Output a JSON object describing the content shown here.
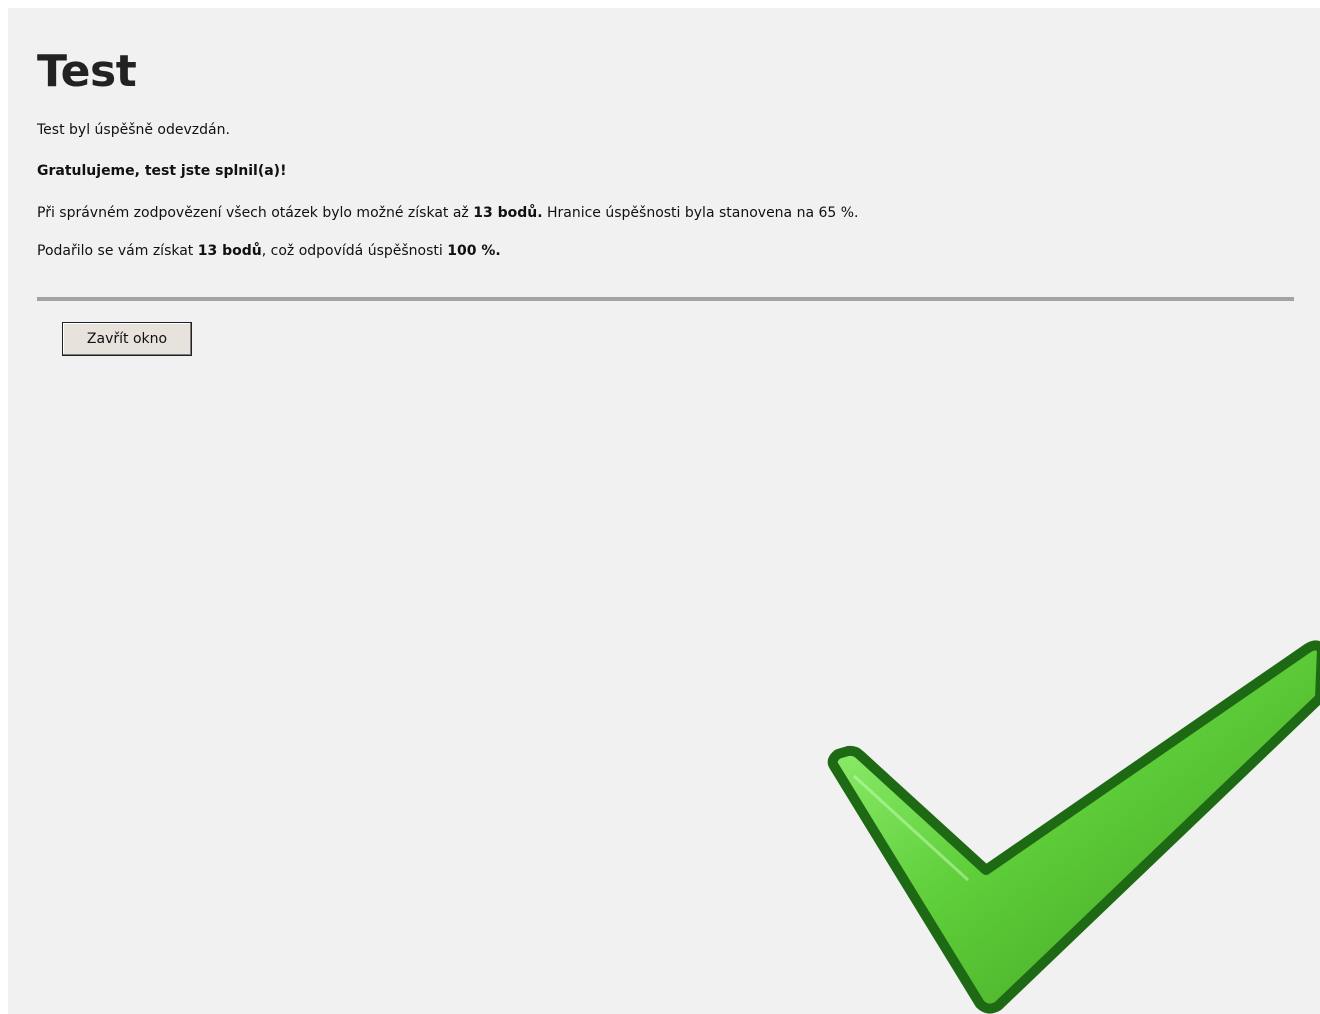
{
  "page": {
    "title": "Test",
    "submitted_message": "Test byl úspěšně odevzdán.",
    "congrats_message": "Gratulujeme, test jste splnil(a)!",
    "max_points_line": {
      "prefix": "Při správném zodpovězení všech otázek bylo možné získat až ",
      "max_points": "13 bodů.",
      "suffix": " Hranice úspěšnosti byla stanovena na 65 %."
    },
    "result_line": {
      "prefix": "Podařilo se vám získat ",
      "points": "13 bodů",
      "middle": ", což odpovídá úspěšnosti ",
      "percent": "100 %.",
      "suffix": ""
    }
  },
  "actions": {
    "close_button_label": "Zavřít okno"
  },
  "icons": {
    "success": "checkmark-icon"
  },
  "colors": {
    "checkmark_fill": "#5fcf3a",
    "checkmark_stroke": "#1e6a14",
    "background": "#f1f1f1",
    "rule": "#a3a3a3"
  }
}
